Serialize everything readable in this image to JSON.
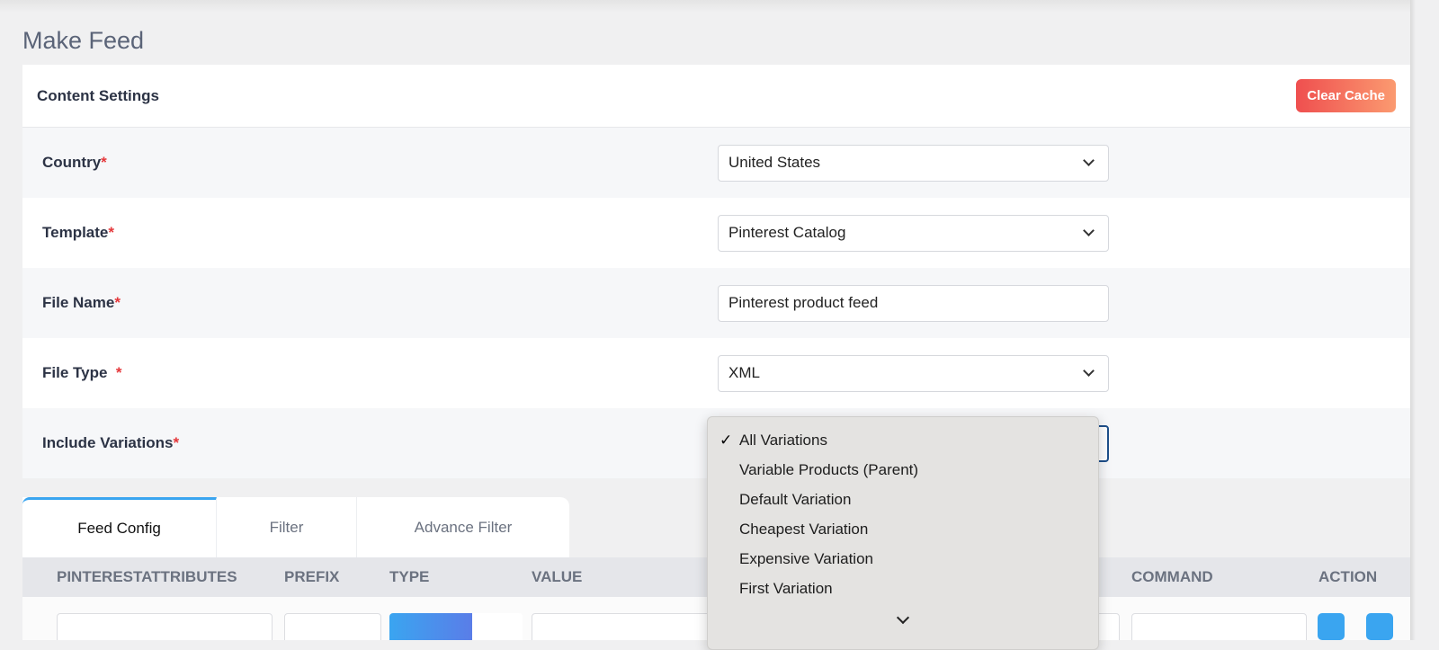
{
  "page": {
    "title": "Make Feed"
  },
  "card": {
    "title": "Content Settings",
    "clear_cache": "Clear Cache"
  },
  "fields": [
    {
      "label": "Country",
      "value": "United States",
      "type": "select"
    },
    {
      "label": "Template",
      "value": "Pinterest Catalog",
      "type": "select"
    },
    {
      "label": "File Name",
      "value": "Pinterest product feed",
      "type": "text"
    },
    {
      "label": "File Type ",
      "value": "XML",
      "type": "select"
    },
    {
      "label": "Include Variations",
      "value": "All Variations",
      "type": "select"
    }
  ],
  "required_mark": "*",
  "dropdown": {
    "selected": "All Variations",
    "check": "✓",
    "options": [
      "All Variations",
      "Variable Products (Parent)",
      "Default Variation",
      "Cheapest Variation",
      "Expensive Variation",
      "First Variation"
    ]
  },
  "tabs": [
    "Feed Config",
    "Filter",
    "Advance Filter"
  ],
  "table": {
    "headers": [
      "PINTERESTATTRIBUTES",
      "PREFIX",
      "TYPE",
      "VALUE",
      "COMMAND",
      "ACTION"
    ]
  },
  "colors": {
    "accent": "#3aa5f0",
    "required": "#e5383b",
    "clear_cache_start": "#ef4f4f",
    "clear_cache_end": "#fb9a70"
  }
}
